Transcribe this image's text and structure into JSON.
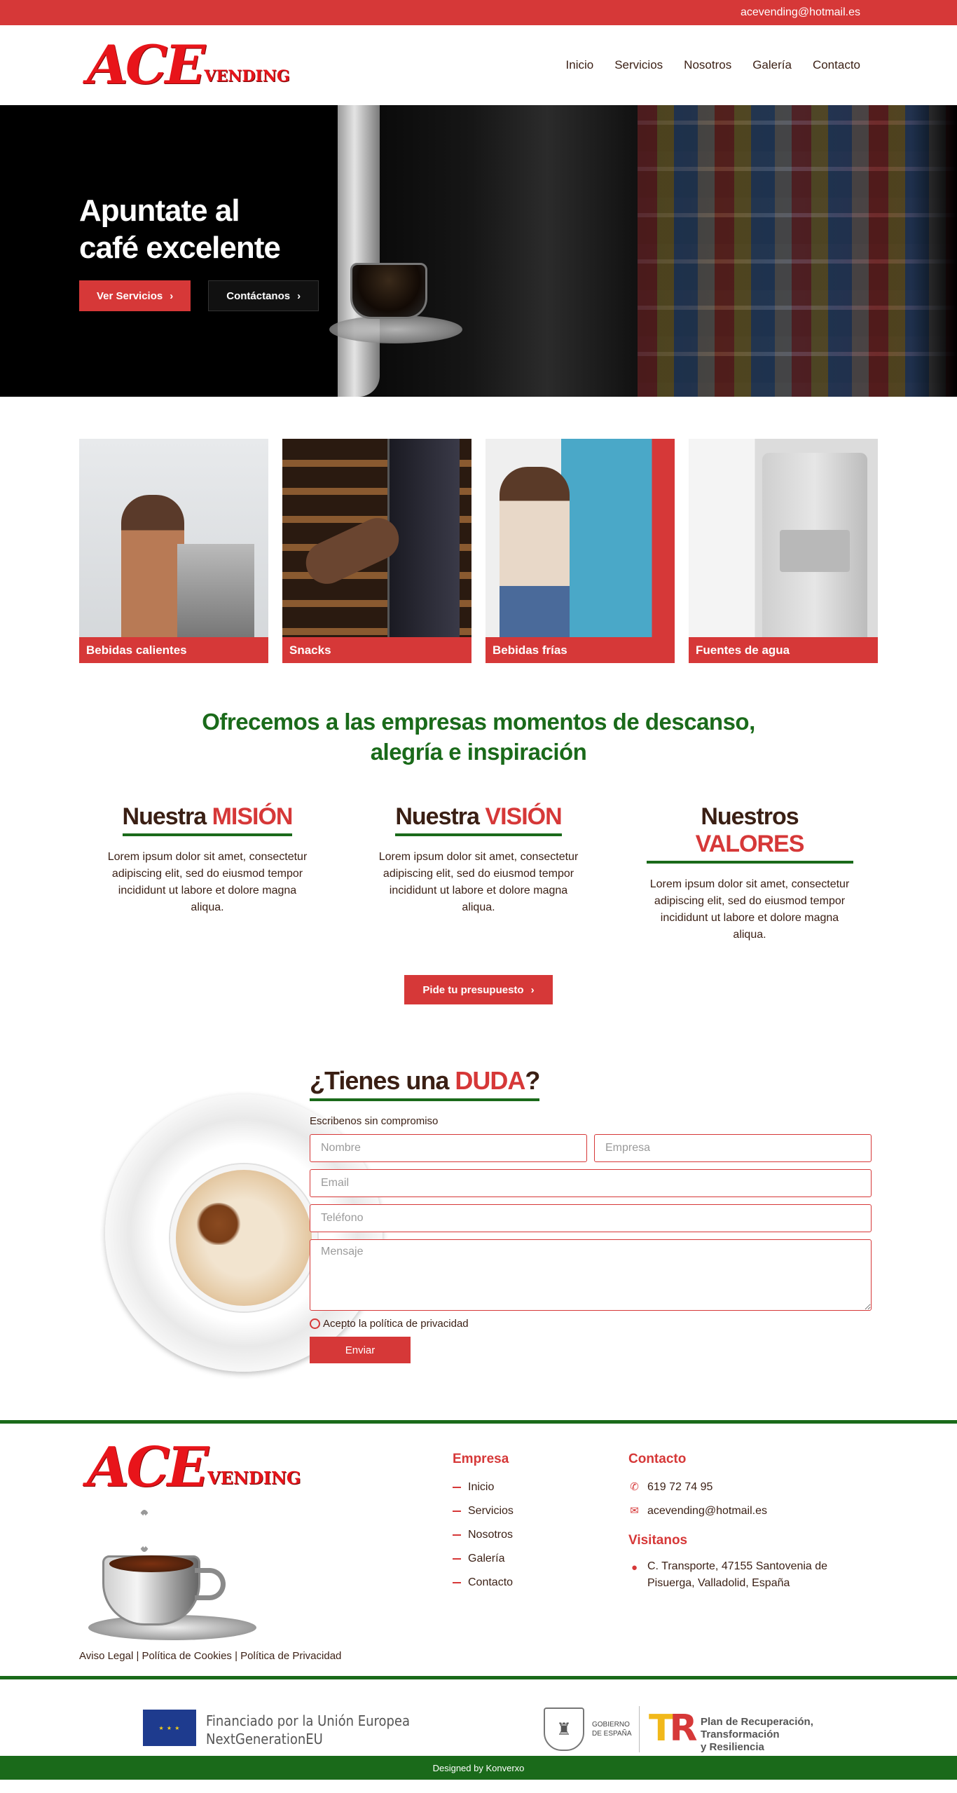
{
  "topbar": {
    "email": "acevending@hotmail.es"
  },
  "brand": {
    "name": "ACE",
    "suffix": "VENDING"
  },
  "nav": [
    {
      "label": "Inicio"
    },
    {
      "label": "Servicios"
    },
    {
      "label": "Nosotros"
    },
    {
      "label": "Galería"
    },
    {
      "label": "Contacto"
    }
  ],
  "hero": {
    "title_line1": "Apuntate al",
    "title_line2": "café excelente",
    "btn_services": "Ver Servicios",
    "btn_contact": "Contáctanos",
    "chevron": "›"
  },
  "categories": [
    {
      "label": "Bebidas calientes"
    },
    {
      "label": "Snacks"
    },
    {
      "label": "Bebidas frías"
    },
    {
      "label": "Fuentes de agua"
    }
  ],
  "offer": {
    "line1": "Ofrecemos a las empresas momentos de descanso,",
    "line2": "alegría e inspiración"
  },
  "mvv": [
    {
      "prefix": "Nuestra",
      "accent": "MISIÓN",
      "text": "Lorem ipsum dolor sit amet, consectetur adipiscing elit, sed do eiusmod tempor incididunt ut labore et dolore magna aliqua."
    },
    {
      "prefix": "Nuestra",
      "accent": "VISIÓN",
      "text": "Lorem ipsum dolor sit amet, consectetur adipiscing elit, sed do eiusmod tempor incididunt ut labore et dolore magna aliqua."
    },
    {
      "prefix": "Nuestros",
      "accent": "VALORES",
      "text": "Lorem ipsum dolor sit amet, consectetur adipiscing elit, sed do eiusmod tempor incididunt ut labore et dolore magna aliqua."
    }
  ],
  "cta": {
    "label": "Pide tu presupuesto"
  },
  "contact": {
    "title_prefix": "¿Tienes una",
    "title_accent": "DUDA",
    "title_suffix": "?",
    "subtitle": "Escribenos sin compromiso",
    "placeholders": {
      "nombre": "Nombre",
      "empresa": "Empresa",
      "email": "Email",
      "telefono": "Teléfono",
      "mensaje": "Mensaje"
    },
    "privacy": "Acepto la política de privacidad",
    "send": "Enviar"
  },
  "footer": {
    "empresa_title": "Empresa",
    "links": [
      {
        "label": "Inicio"
      },
      {
        "label": "Servicios"
      },
      {
        "label": "Nosotros"
      },
      {
        "label": "Galería"
      },
      {
        "label": "Contacto"
      }
    ],
    "contacto_title": "Contacto",
    "phone": "619 72 74 95",
    "email": "acevending@hotmail.es",
    "visitanos_title": "Visitanos",
    "address_line1": "C. Transporte, 47155 Santovenia de",
    "address_line2": "Pisuerga, Valladolid, España",
    "legal": "Aviso Legal | Política de Cookies | Política de Privacidad"
  },
  "funding": {
    "eu_line1": "Financiado por la Unión Europea",
    "eu_line2": "NextGenerationEU",
    "gob_line1": "GOBIERNO",
    "gob_line2": "DE ESPAÑA",
    "plan_line1": "Plan de Recuperación,",
    "plan_line2": "Transformación",
    "plan_line3": "y Resiliencia"
  },
  "credits": "Designed by Konverxo",
  "icons": {
    "phone": "phone-icon",
    "mail": "mail-icon",
    "location": "location-icon",
    "chevron": "chevron-right-icon"
  },
  "colors": {
    "brand_red": "#d63838",
    "brand_green": "#1a6a1a",
    "text_brown": "#3a1f14"
  }
}
